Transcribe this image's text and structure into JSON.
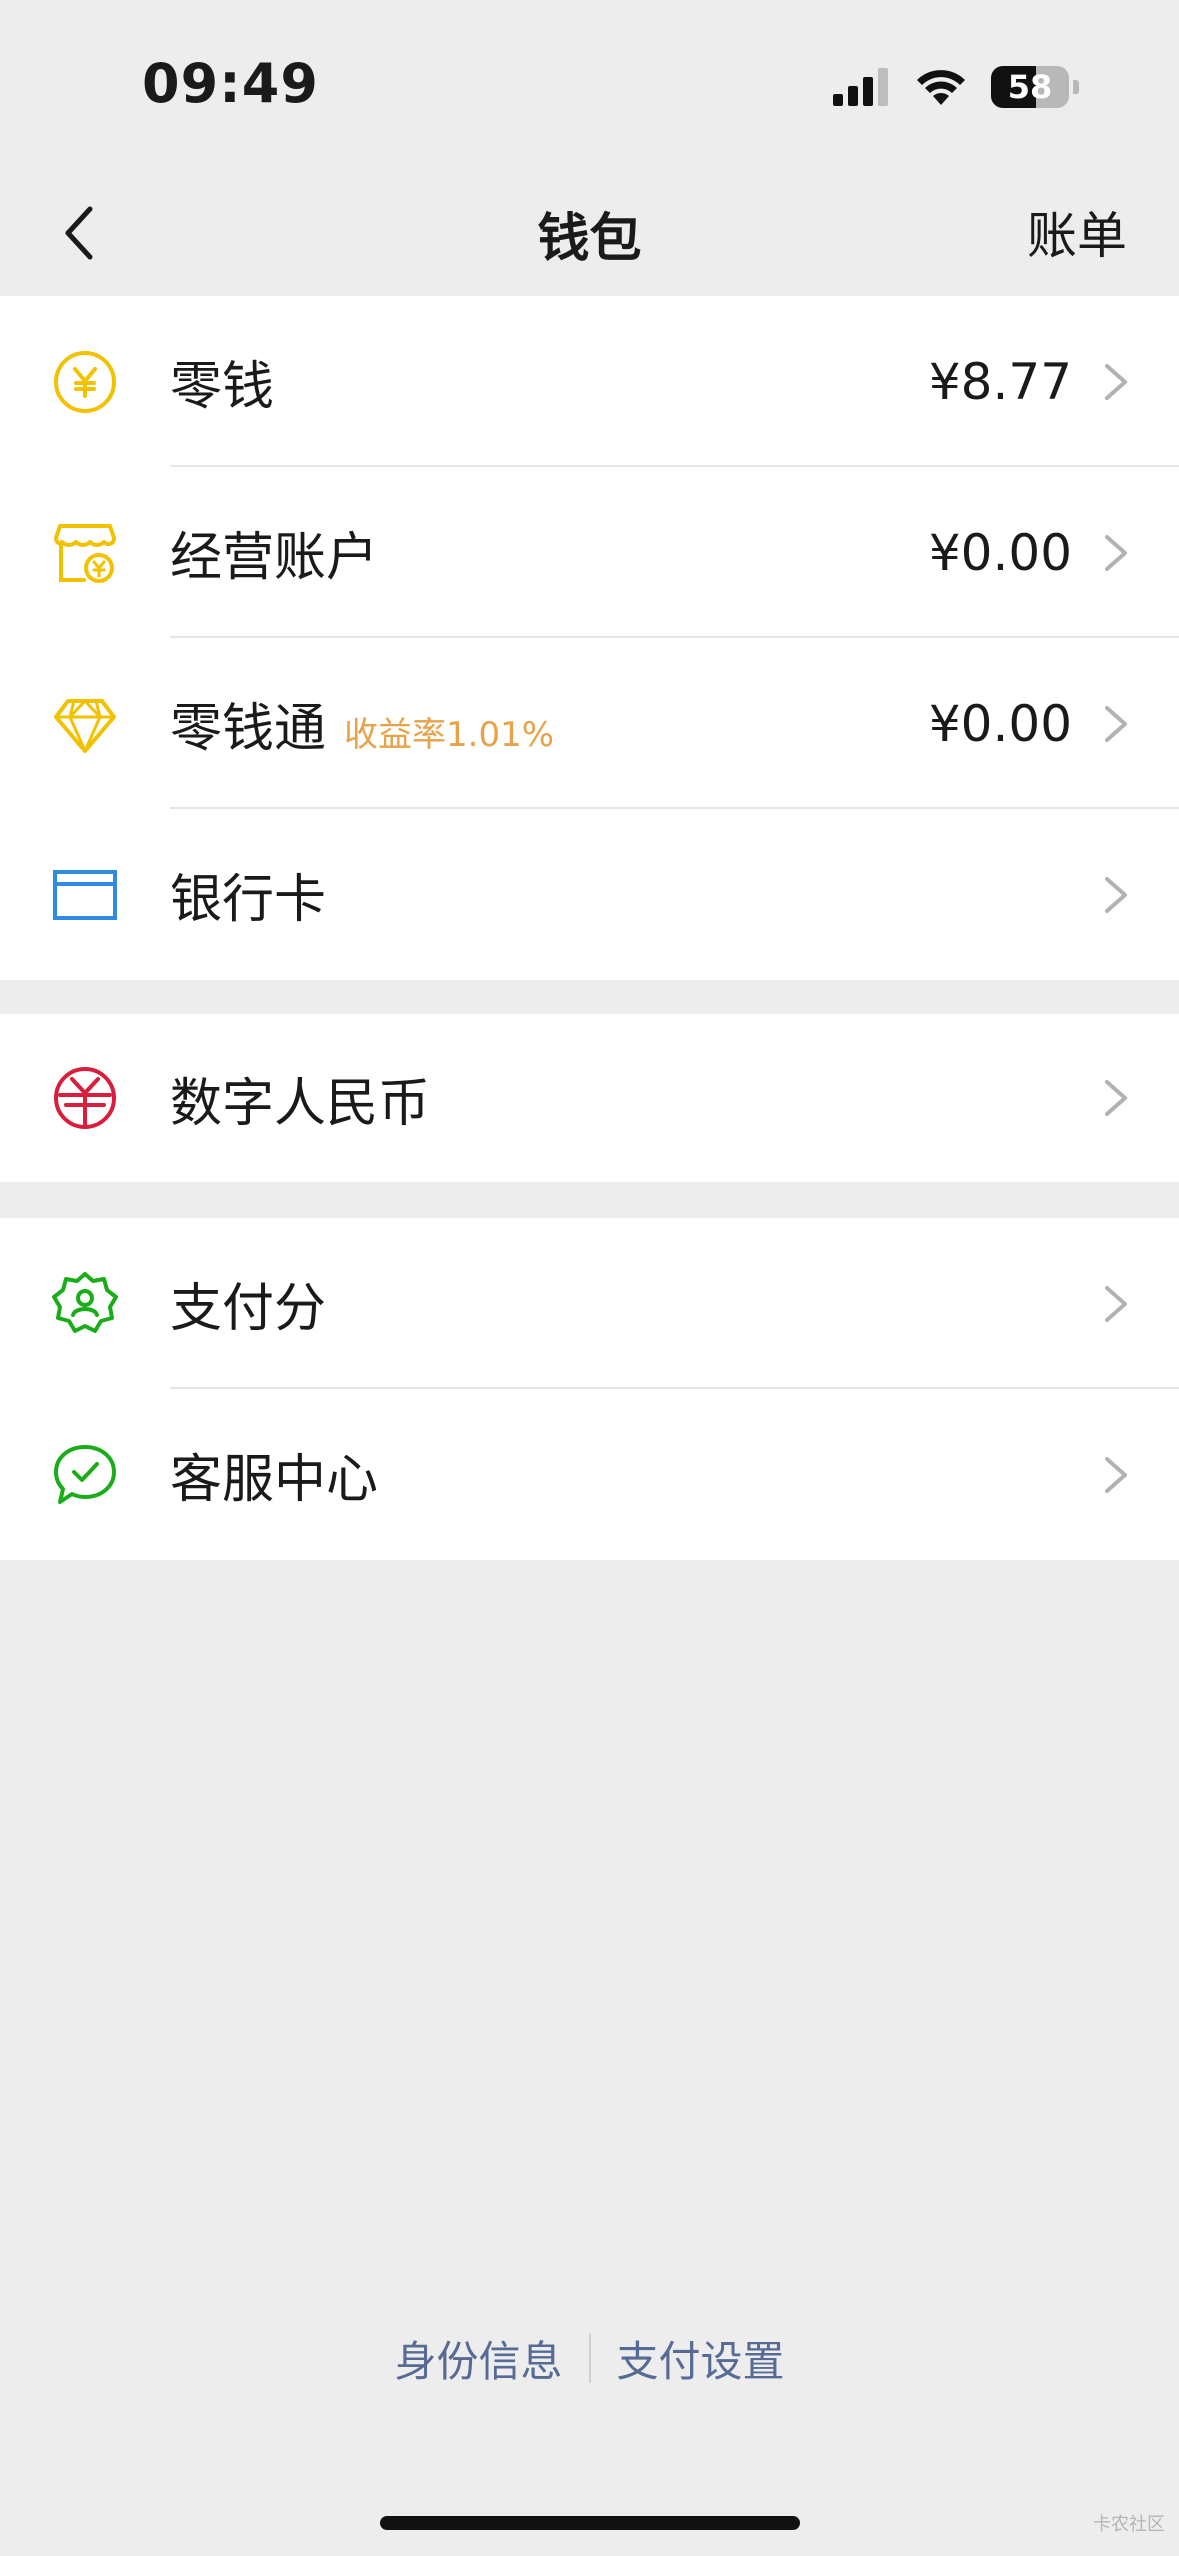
{
  "status_bar": {
    "time": "09:49",
    "battery": "58",
    "battery_level": 0.58
  },
  "nav": {
    "title": "钱包",
    "right_action": "账单"
  },
  "groups": [
    {
      "items": [
        {
          "label": "零钱",
          "amount": "¥8.77",
          "icon": "yen-coin-icon",
          "color": "#f2c100"
        },
        {
          "label": "经营账户",
          "amount": "¥0.00",
          "icon": "shop-icon",
          "color": "#f2c100"
        },
        {
          "label": "零钱通",
          "rate": "收益率1.01%",
          "amount": "¥0.00",
          "icon": "diamond-icon",
          "color": "#f2c100"
        },
        {
          "label": "银行卡",
          "icon": "card-icon",
          "color": "#2f8be0"
        }
      ]
    },
    {
      "items": [
        {
          "label": "数字人民币",
          "icon": "digital-rmb-icon",
          "color": "#d81e3c"
        }
      ]
    },
    {
      "items": [
        {
          "label": "支付分",
          "icon": "payscore-badge-icon",
          "color": "#1aad19"
        },
        {
          "label": "客服中心",
          "icon": "chat-bubble-icon",
          "color": "#1aad19"
        }
      ]
    }
  ],
  "footer": {
    "links": [
      "身份信息",
      "支付设置"
    ]
  },
  "watermark": "卡农社区"
}
